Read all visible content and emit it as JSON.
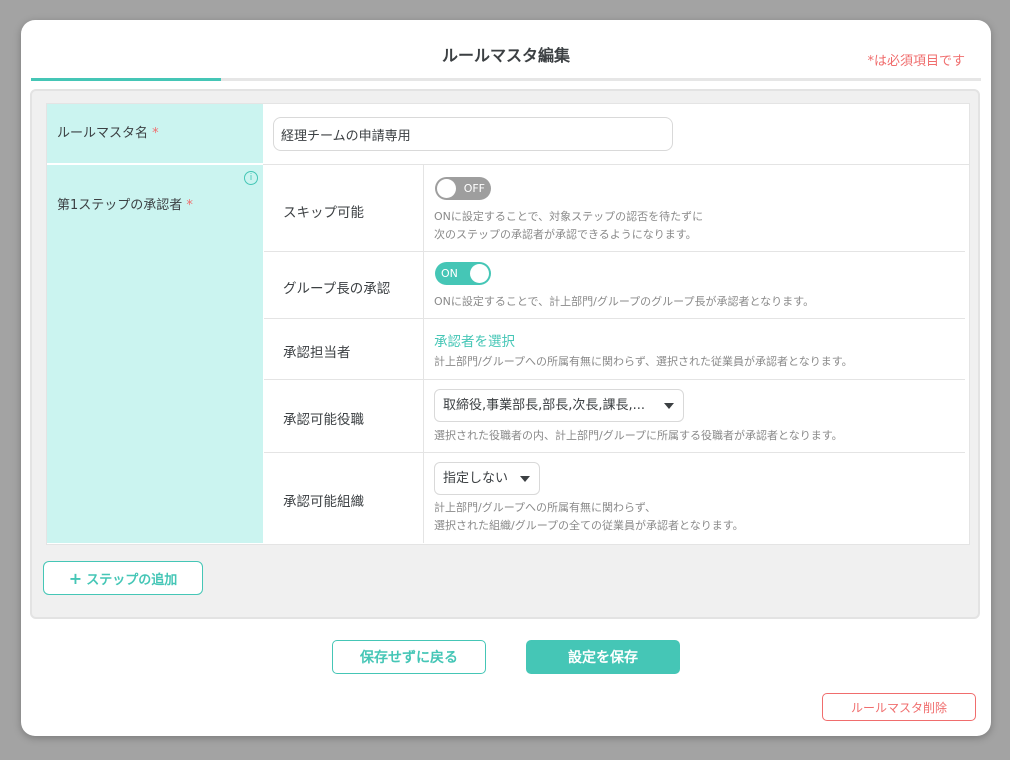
{
  "modal": {
    "title": "ルールマスタ編集",
    "required_note": "*は必須項目です"
  },
  "form": {
    "rule_name": {
      "label": "ルールマスタ名",
      "required_mark": "*",
      "value": "経理チームの申請専用"
    },
    "step1": {
      "label": "第1ステップの承認者",
      "required_mark": "*",
      "info_icon": "info-icon",
      "skip": {
        "label": "スキップ可能",
        "toggle_text": "OFF",
        "enabled": false,
        "desc_line1": "ONに設定することで、対象ステップの認否を待たずに",
        "desc_line2": "次のステップの承認者が承認できるようになります。"
      },
      "group_leader": {
        "label": "グループ長の承認",
        "toggle_text": "ON",
        "enabled": true,
        "desc": "ONに設定することで、計上部門/グループのグループ長が承認者となります。"
      },
      "approver": {
        "label": "承認担当者",
        "link": "承認者を選択",
        "desc": "計上部門/グループへの所属有無に関わらず、選択された従業員が承認者となります。"
      },
      "positions": {
        "label": "承認可能役職",
        "selected": "取締役,事業部長,部長,次長,課長,...",
        "desc": "選択された役職者の内、計上部門/グループに所属する役職者が承認者となります。"
      },
      "organization": {
        "label": "承認可能組織",
        "selected": "指定しない",
        "desc_line1": "計上部門/グループへの所属有無に関わらず、",
        "desc_line2": "選択された組織/グループの全ての従業員が承認者となります。"
      }
    },
    "add_step": {
      "icon": "plus-icon",
      "label": "ステップの追加"
    }
  },
  "footer": {
    "back_label": "保存せずに戻る",
    "save_label": "設定を保存",
    "delete_label": "ルールマスタ削除"
  },
  "colors": {
    "accent": "#45c6b6",
    "required": "#f06d6d",
    "label_bg": "#cbf4f0"
  }
}
